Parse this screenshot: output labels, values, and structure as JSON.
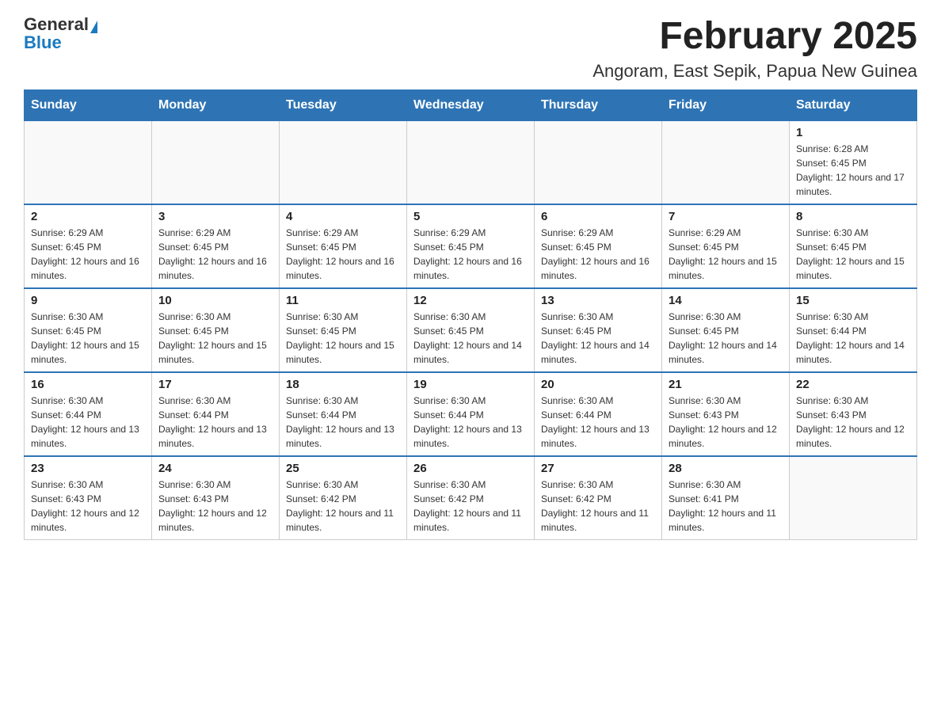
{
  "logo": {
    "general": "General",
    "triangle": "▲",
    "blue": "Blue"
  },
  "title": "February 2025",
  "subtitle": "Angoram, East Sepik, Papua New Guinea",
  "weekdays": [
    "Sunday",
    "Monday",
    "Tuesday",
    "Wednesday",
    "Thursday",
    "Friday",
    "Saturday"
  ],
  "weeks": [
    [
      {
        "day": "",
        "info": ""
      },
      {
        "day": "",
        "info": ""
      },
      {
        "day": "",
        "info": ""
      },
      {
        "day": "",
        "info": ""
      },
      {
        "day": "",
        "info": ""
      },
      {
        "day": "",
        "info": ""
      },
      {
        "day": "1",
        "info": "Sunrise: 6:28 AM\nSunset: 6:45 PM\nDaylight: 12 hours and 17 minutes."
      }
    ],
    [
      {
        "day": "2",
        "info": "Sunrise: 6:29 AM\nSunset: 6:45 PM\nDaylight: 12 hours and 16 minutes."
      },
      {
        "day": "3",
        "info": "Sunrise: 6:29 AM\nSunset: 6:45 PM\nDaylight: 12 hours and 16 minutes."
      },
      {
        "day": "4",
        "info": "Sunrise: 6:29 AM\nSunset: 6:45 PM\nDaylight: 12 hours and 16 minutes."
      },
      {
        "day": "5",
        "info": "Sunrise: 6:29 AM\nSunset: 6:45 PM\nDaylight: 12 hours and 16 minutes."
      },
      {
        "day": "6",
        "info": "Sunrise: 6:29 AM\nSunset: 6:45 PM\nDaylight: 12 hours and 16 minutes."
      },
      {
        "day": "7",
        "info": "Sunrise: 6:29 AM\nSunset: 6:45 PM\nDaylight: 12 hours and 15 minutes."
      },
      {
        "day": "8",
        "info": "Sunrise: 6:30 AM\nSunset: 6:45 PM\nDaylight: 12 hours and 15 minutes."
      }
    ],
    [
      {
        "day": "9",
        "info": "Sunrise: 6:30 AM\nSunset: 6:45 PM\nDaylight: 12 hours and 15 minutes."
      },
      {
        "day": "10",
        "info": "Sunrise: 6:30 AM\nSunset: 6:45 PM\nDaylight: 12 hours and 15 minutes."
      },
      {
        "day": "11",
        "info": "Sunrise: 6:30 AM\nSunset: 6:45 PM\nDaylight: 12 hours and 15 minutes."
      },
      {
        "day": "12",
        "info": "Sunrise: 6:30 AM\nSunset: 6:45 PM\nDaylight: 12 hours and 14 minutes."
      },
      {
        "day": "13",
        "info": "Sunrise: 6:30 AM\nSunset: 6:45 PM\nDaylight: 12 hours and 14 minutes."
      },
      {
        "day": "14",
        "info": "Sunrise: 6:30 AM\nSunset: 6:45 PM\nDaylight: 12 hours and 14 minutes."
      },
      {
        "day": "15",
        "info": "Sunrise: 6:30 AM\nSunset: 6:44 PM\nDaylight: 12 hours and 14 minutes."
      }
    ],
    [
      {
        "day": "16",
        "info": "Sunrise: 6:30 AM\nSunset: 6:44 PM\nDaylight: 12 hours and 13 minutes."
      },
      {
        "day": "17",
        "info": "Sunrise: 6:30 AM\nSunset: 6:44 PM\nDaylight: 12 hours and 13 minutes."
      },
      {
        "day": "18",
        "info": "Sunrise: 6:30 AM\nSunset: 6:44 PM\nDaylight: 12 hours and 13 minutes."
      },
      {
        "day": "19",
        "info": "Sunrise: 6:30 AM\nSunset: 6:44 PM\nDaylight: 12 hours and 13 minutes."
      },
      {
        "day": "20",
        "info": "Sunrise: 6:30 AM\nSunset: 6:44 PM\nDaylight: 12 hours and 13 minutes."
      },
      {
        "day": "21",
        "info": "Sunrise: 6:30 AM\nSunset: 6:43 PM\nDaylight: 12 hours and 12 minutes."
      },
      {
        "day": "22",
        "info": "Sunrise: 6:30 AM\nSunset: 6:43 PM\nDaylight: 12 hours and 12 minutes."
      }
    ],
    [
      {
        "day": "23",
        "info": "Sunrise: 6:30 AM\nSunset: 6:43 PM\nDaylight: 12 hours and 12 minutes."
      },
      {
        "day": "24",
        "info": "Sunrise: 6:30 AM\nSunset: 6:43 PM\nDaylight: 12 hours and 12 minutes."
      },
      {
        "day": "25",
        "info": "Sunrise: 6:30 AM\nSunset: 6:42 PM\nDaylight: 12 hours and 11 minutes."
      },
      {
        "day": "26",
        "info": "Sunrise: 6:30 AM\nSunset: 6:42 PM\nDaylight: 12 hours and 11 minutes."
      },
      {
        "day": "27",
        "info": "Sunrise: 6:30 AM\nSunset: 6:42 PM\nDaylight: 12 hours and 11 minutes."
      },
      {
        "day": "28",
        "info": "Sunrise: 6:30 AM\nSunset: 6:41 PM\nDaylight: 12 hours and 11 minutes."
      },
      {
        "day": "",
        "info": ""
      }
    ]
  ]
}
